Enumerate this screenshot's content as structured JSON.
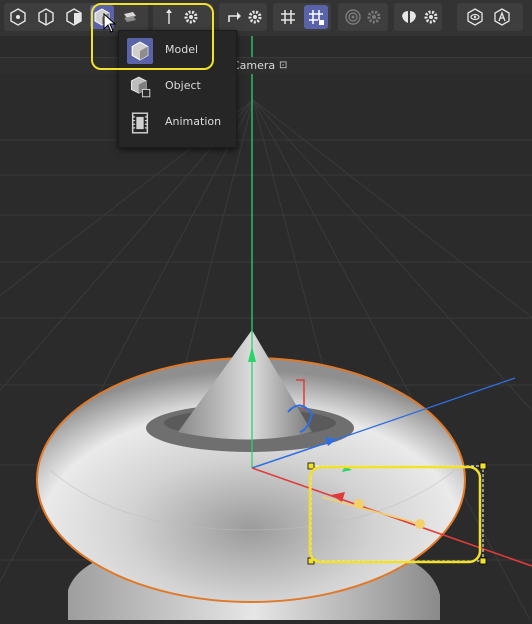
{
  "toolbar": {
    "buttons": [
      {
        "name": "points-mode-button",
        "icon": "points-mode-icon",
        "active": false
      },
      {
        "name": "edges-mode-button",
        "icon": "edges-mode-icon",
        "active": false
      },
      {
        "name": "polygons-mode-button",
        "icon": "polygons-mode-icon",
        "active": false
      },
      {
        "name": "model-mode-button",
        "icon": "model-mode-icon",
        "active": true
      },
      {
        "name": "uv-mode-button",
        "icon": "uv-mode-icon",
        "active": false
      },
      {
        "name": "axis-mode-button",
        "icon": "axis-mode-icon",
        "active": false
      },
      {
        "name": "axis-settings-button",
        "icon": "gear-icon",
        "active": false
      },
      {
        "name": "snap-button",
        "icon": "snap-icon",
        "active": false
      },
      {
        "name": "snap-settings-button",
        "icon": "gear-icon",
        "active": false
      },
      {
        "name": "grid-button",
        "icon": "grid-icon",
        "active": false
      },
      {
        "name": "workplane-lock-button",
        "icon": "grid-lock-icon",
        "active": true
      },
      {
        "name": "soft-selection-button",
        "icon": "soft-selection-icon",
        "active": false
      },
      {
        "name": "soft-selection-settings-button",
        "icon": "gear-icon",
        "active": false
      },
      {
        "name": "symmetry-button",
        "icon": "symmetry-icon",
        "active": false
      },
      {
        "name": "symmetry-settings-button",
        "icon": "gear-icon",
        "active": false
      },
      {
        "name": "view-mode-button",
        "icon": "eye-icon",
        "active": false
      },
      {
        "name": "auto-button",
        "icon": "auto-icon",
        "active": false
      }
    ]
  },
  "camera_bar": {
    "label": "Camera",
    "icon": "camera-lock-icon"
  },
  "dropdown": {
    "items": [
      {
        "label": "Model",
        "icon": "model-mode-icon",
        "selected": true
      },
      {
        "label": "Object",
        "icon": "object-mode-icon",
        "selected": false
      },
      {
        "label": "Animation",
        "icon": "animation-mode-icon",
        "selected": false
      }
    ]
  },
  "colors": {
    "accent": "#5b63a8",
    "highlight": "#f2e12a",
    "axis_x": "#e03b3b",
    "axis_y": "#2bd36b",
    "axis_z": "#2f6fe0",
    "selection_outline": "#e07a2a",
    "rotate_handle": "#2f6fe0",
    "path": "#f3d06a"
  }
}
